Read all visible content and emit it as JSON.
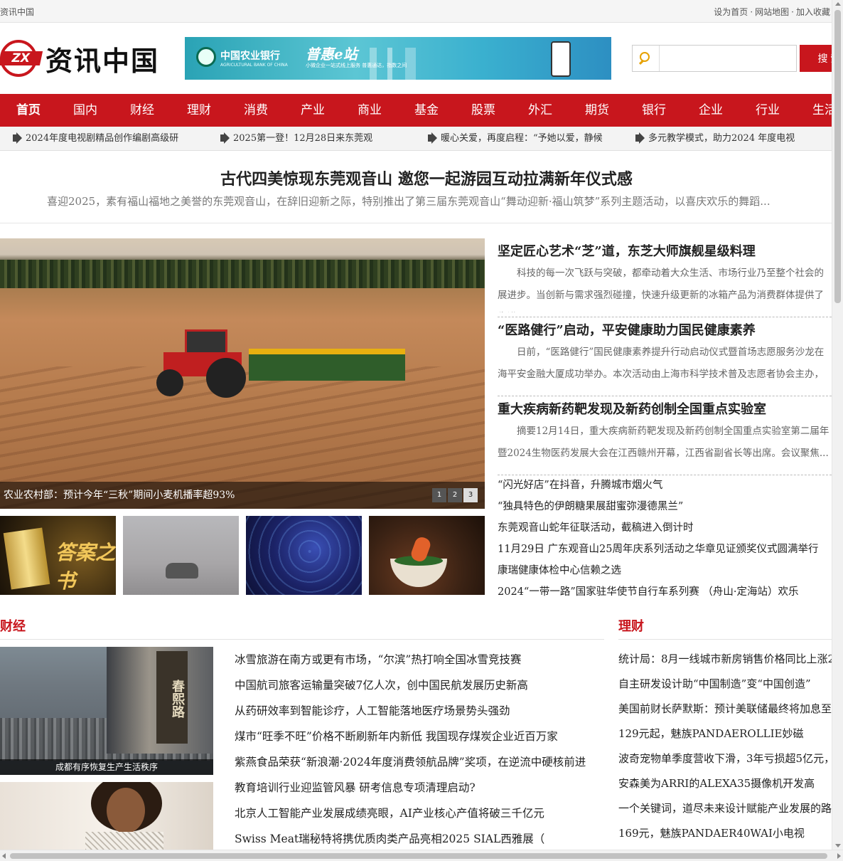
{
  "topbar": {
    "site_name": "资讯中国",
    "links": [
      "设为首页",
      "网站地图",
      "加入收藏"
    ]
  },
  "logo": {
    "mark": "ZX",
    "text": "资讯中国"
  },
  "banner": {
    "bank": "中国农业银行",
    "bank_en": "AGRICULTURAL BANK OF CHINA",
    "product": "普惠e站",
    "slogan": "小微企业一站式线上服务 普惠通达，指数之间"
  },
  "search": {
    "button": "搜 索",
    "placeholder": ""
  },
  "nav": [
    "首页",
    "国内",
    "财经",
    "理财",
    "消费",
    "产业",
    "商业",
    "基金",
    "股票",
    "外汇",
    "期货",
    "银行",
    "企业",
    "行业",
    "生活"
  ],
  "ticker": [
    "2024年度电视剧精品创作编剧高级研",
    "2025第一登！12月28日来东莞观",
    "暖心关爱，再度启程：“予她以爱，静候",
    "多元教学模式，助力2024 年度电视"
  ],
  "headline": {
    "title": "古代四美惊现东莞观音山 邀您一起游园互动拉满新年仪式感",
    "summary": "喜迎2025，素有福山福地之美誉的东莞观音山，在辞旧迎新之际，特别推出了第三届东莞观音山“舞动迎新·福山筑梦”系列主题活动，以喜庆欢乐的舞蹈..."
  },
  "slider": {
    "caption": "农业农村部：预计今年“三秋”期间小麦机播率超93%",
    "pages": [
      "1",
      "2",
      "3"
    ],
    "active_page": 3
  },
  "thumbs": {
    "book_text": "答案之书"
  },
  "right_news": [
    {
      "title": "坚定匠心艺术“芝”道，东芝大师旗舰星级料理",
      "summary": "科技的每一次飞跃与突破，都牵动着大众生活、市场行业乃至整个社会的展进步。当创新与需求强烈碰撞，快速升级更新的冰箱产品为消费群体提供了先进"
    },
    {
      "title": "“医路健行”启动，平安健康助力国民健康素养",
      "summary": "日前，“医路健行”国民健康素养提升行动启动仪式暨首场志愿服务沙龙在海平安金融大厦成功举办。本次活动由上海市科学技术普及志愿者协会主办，因"
    },
    {
      "title": "重大疾病新药靶发现及新药创制全国重点实验室",
      "summary": "摘要12月14日，重大疾病新药靶发现及新药创制全国重点实验室第二届年暨2024生物医药发展大会在江西赣州开幕，江西省副省长等出席。会议聚焦..."
    }
  ],
  "right_list": [
    "“闪光好店”在抖音，升腾城市烟火气",
    "“独具特色的伊朗糖果展甜蜜弥漫德黑兰”",
    "东莞观音山蛇年征联活动，截稿进入倒计时",
    "11月29日 广东观音山25周年庆系列活动之华章见证颁奖仪式圆满举行",
    "康瑞健康体检中心信赖之选",
    "2024“一带一路”国家驻华使节自行车系列赛 （舟山·定海站）欢乐"
  ],
  "caijing": {
    "title": "财经",
    "image_caption": "成都有序恢复生产生活秩序",
    "sign_text": "春熙路",
    "items": [
      "冰雪旅游在南方或更有市场，“尔滨”热打响全国冰雪竞技赛",
      "中国航司旅客运输量突破7亿人次，创中国民航发展历史新高",
      "从药研效率到智能诊疗，人工智能落地医疗场景势头强劲",
      "煤市“旺季不旺”价格不断刷新年内新低 我国现存煤炭企业近百万家",
      "紫燕食品荣获“新浪潮·2024年度消费领航品牌”奖项，在逆流中硬核前进",
      "教育培训行业迎监管风暴 研考信息专项清理启动?",
      "北京人工智能产业发展成绩亮眼，AI产业核心产值将破三千亿元",
      "Swiss Meat瑞秘特将携优质肉类产品亮相2025 SIAL西雅展（"
    ]
  },
  "licai": {
    "title": "理财",
    "items": [
      "统计局：8月一线城市新房销售价格同比上涨2",
      "自主研发设计助“中国制造”变“中国创造”",
      "美国前财长萨默斯：预计美联储最终将加息至",
      "129元起，魅族PANDAEROLLIE妙磁",
      "波奇宠物单季度营收下滑，3年亏损超5亿元，",
      "安森美为ARRI的ALEXA35摄像机开发高",
      "一个关键词，道尽未来设计赋能产业发展的路",
      "169元，魅族PANDAER40WAI小电视"
    ]
  }
}
